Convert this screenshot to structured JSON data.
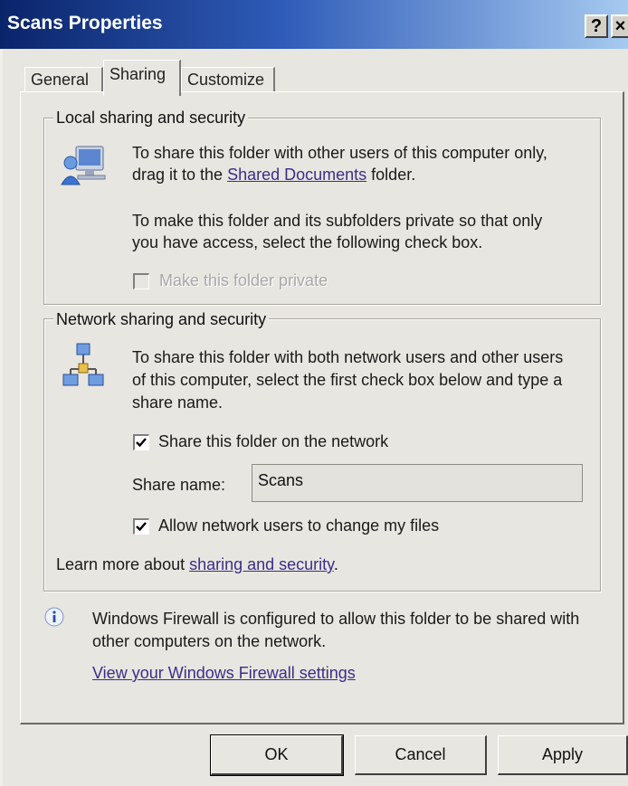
{
  "window": {
    "title": "Scans Properties",
    "help_glyph": "?",
    "close_glyph": "×"
  },
  "tabs": [
    {
      "label": "General"
    },
    {
      "label": "Sharing"
    },
    {
      "label": "Customize"
    }
  ],
  "local_group": {
    "title": "Local sharing and security",
    "line1": "To share this folder with other users of this computer only,",
    "line2_prefix": "drag it to the ",
    "line2_link": "Shared Documents",
    "line2_suffix": " folder.",
    "private_line1": "To make this folder and its subfolders private so that only",
    "private_line2": "you have access, select the following check box.",
    "private_checkbox_label": "Make this folder private",
    "private_checked": false
  },
  "network_group": {
    "title": "Network sharing and security",
    "line1": "To share this folder with both network users and other users",
    "line2": "of this computer, select the first check box below and type a",
    "line3": "share name.",
    "share_checkbox_label": "Share this folder on the network",
    "share_checked": true,
    "share_name_label": "Share name:",
    "share_name_value": "Scans",
    "allow_checkbox_label": "Allow network users to change my files",
    "allow_checked": true,
    "learn_prefix": "Learn more about ",
    "learn_link": "sharing and security",
    "learn_suffix": "."
  },
  "firewall": {
    "line1": "Windows Firewall is configured to allow this folder to be shared with",
    "line2": "other computers on the network.",
    "link": "View your Windows Firewall settings"
  },
  "buttons": {
    "ok": "OK",
    "cancel": "Cancel",
    "apply": "Apply"
  }
}
